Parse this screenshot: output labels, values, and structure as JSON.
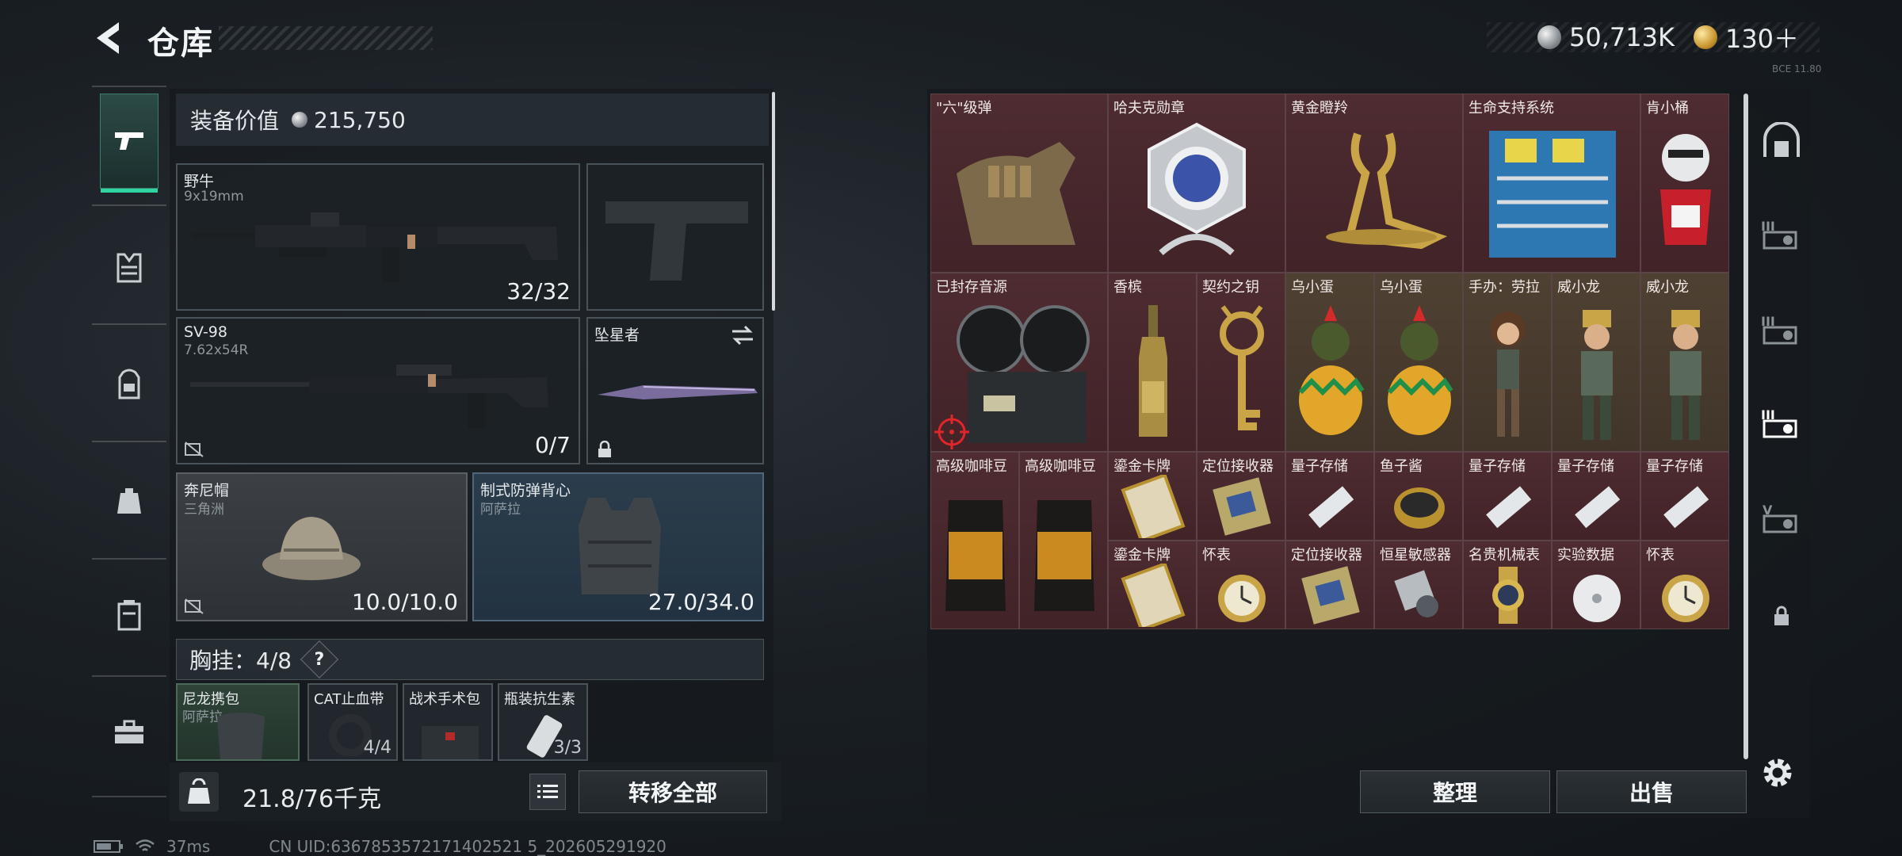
{
  "header": {
    "title": "仓库",
    "currency_silver": "50,713K",
    "currency_gold": "130＋",
    "version": "ВСЕ 11.80"
  },
  "equipment": {
    "value_label": "装备价值",
    "value": "215,750"
  },
  "slots": {
    "primary": {
      "name": "野牛",
      "sub": "9x19mm",
      "count": "32/32"
    },
    "sniper": {
      "name": "SV-98",
      "sub": "7.62x54R",
      "count": "0/7"
    },
    "melee": {
      "name": "坠星者"
    },
    "helmet": {
      "name": "奔尼帽",
      "sub": "三角洲",
      "count": "10.0/10.0"
    },
    "armor": {
      "name": "制式防弹背心",
      "sub": "阿萨拉",
      "count": "27.0/34.0"
    }
  },
  "chest": {
    "label": "胸挂：4/8",
    "help": "?",
    "items": [
      {
        "name": "尼龙携包",
        "sub": "阿萨拉",
        "count": ""
      },
      {
        "name": "CAT止血带",
        "sub": "",
        "count": "4/4"
      },
      {
        "name": "战术手术包",
        "sub": "",
        "count": ""
      },
      {
        "name": "瓶装抗生素",
        "sub": "",
        "count": "3/3"
      }
    ]
  },
  "capacity": {
    "weight": "21.8/76千克",
    "kg": "KG"
  },
  "buttons": {
    "transfer_all": "转移全部",
    "organize": "整理",
    "sell": "出售"
  },
  "storage": {
    "items": [
      {
        "label": "\"六\"级弹"
      },
      {
        "label": "哈夫克勋章"
      },
      {
        "label": "黄金瞪羚"
      },
      {
        "label": "生命支持系统"
      },
      {
        "label": "肯小桶"
      },
      {
        "label": "已封存音源"
      },
      {
        "label": "香槟"
      },
      {
        "label": "契约之钥"
      },
      {
        "label": "乌小蛋"
      },
      {
        "label": "乌小蛋"
      },
      {
        "label": "手办：劳拉"
      },
      {
        "label": "威小龙"
      },
      {
        "label": "威小龙"
      },
      {
        "label": "高级咖啡豆"
      },
      {
        "label": "高级咖啡豆"
      },
      {
        "label": "鎏金卡牌"
      },
      {
        "label": "定位接收器"
      },
      {
        "label": "量子存储"
      },
      {
        "label": "鱼子酱"
      },
      {
        "label": "量子存储"
      },
      {
        "label": "量子存储"
      },
      {
        "label": "量子存储"
      },
      {
        "label": "鎏金卡牌"
      },
      {
        "label": "怀表"
      },
      {
        "label": "定位接收器"
      },
      {
        "label": "恒星敏感器"
      },
      {
        "label": "名贵机械表"
      },
      {
        "label": "实验数据"
      },
      {
        "label": "怀表"
      }
    ]
  },
  "status": {
    "ping": "37ms",
    "uid": "CN UID:6367853572171402521 5_202605291920"
  },
  "colors": {
    "accent": "#2fd4a0",
    "red_cell": "#4e2c31",
    "gold_cell": "#4f4132"
  }
}
